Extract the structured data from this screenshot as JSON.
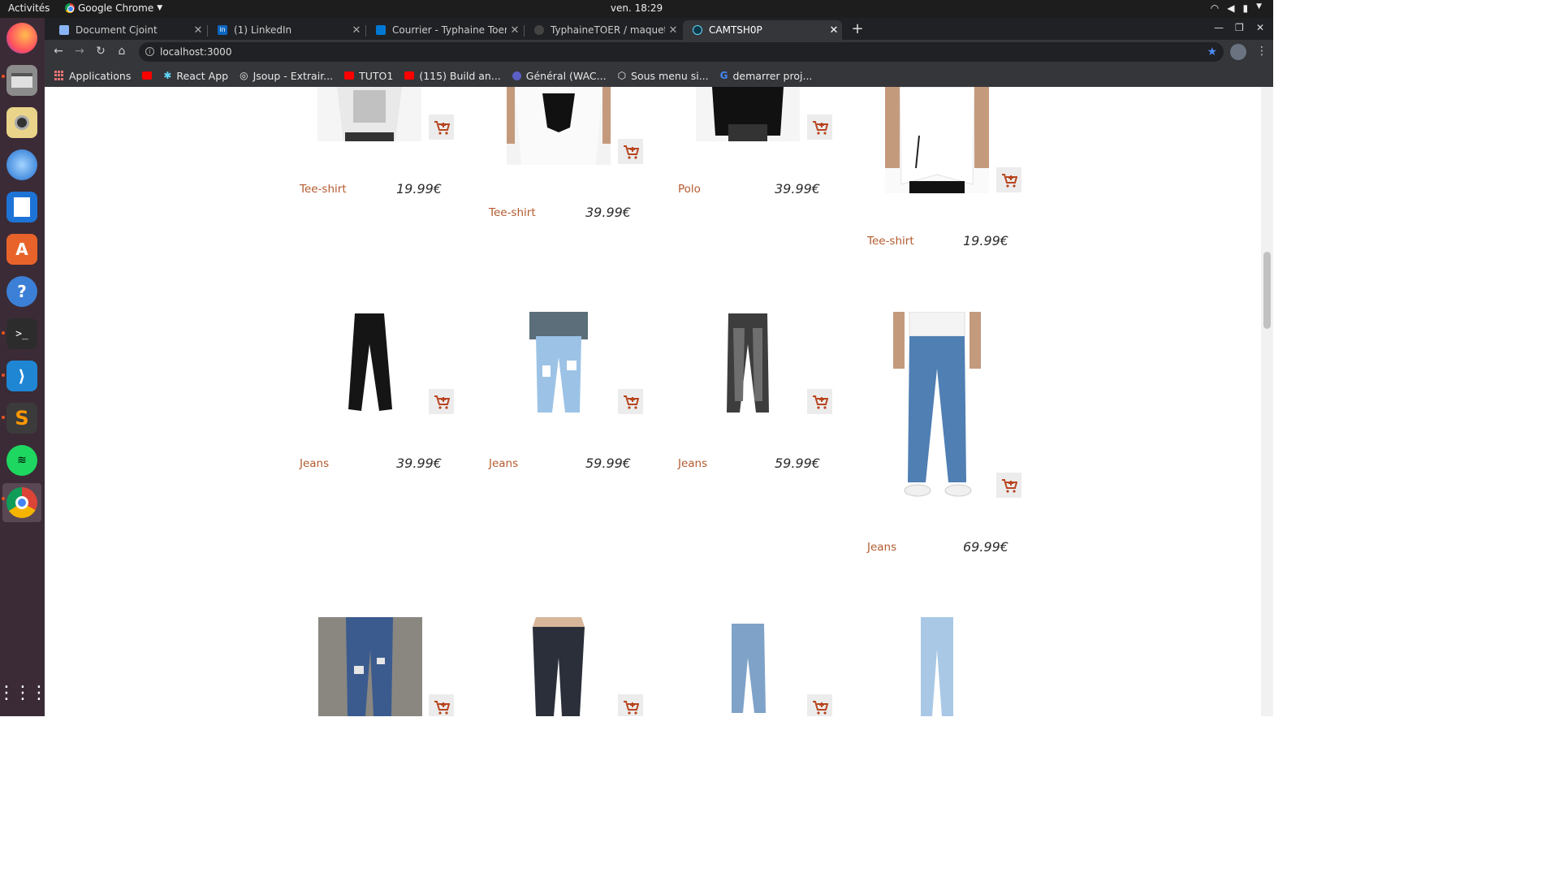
{
  "system": {
    "activities": "Activités",
    "app_name": "Google Chrome",
    "clock": "ven. 18:29"
  },
  "tabs": [
    {
      "title": "Document Cjoint",
      "favicon_color": "#8ab4f8"
    },
    {
      "title": "(1) LinkedIn",
      "favicon_color": "#0a66c2"
    },
    {
      "title": "Courrier - Typhaine Toer -",
      "favicon_color": "#0078d4"
    },
    {
      "title": "TyphaineTOER / maquette",
      "favicon_color": "#444444"
    },
    {
      "title": "CAMTSH0P",
      "favicon_color": "#61dafb"
    }
  ],
  "address_bar": {
    "url": "localhost:3000"
  },
  "bookmarks": [
    {
      "label": "Applications",
      "icon": "apps-grid-icon"
    },
    {
      "label": "",
      "icon": "youtube-icon"
    },
    {
      "label": "React App",
      "icon": "react-icon"
    },
    {
      "label": "Jsoup - Extrair...",
      "icon": "globe-icon"
    },
    {
      "label": "TUTO1",
      "icon": "youtube-icon"
    },
    {
      "label": "(115) Build an...",
      "icon": "youtube-icon"
    },
    {
      "label": "Général (WAC...",
      "icon": "teams-icon"
    },
    {
      "label": "Sous menu si...",
      "icon": "codepen-icon"
    },
    {
      "label": "demarrer proj...",
      "icon": "google-icon"
    }
  ],
  "products": [
    {
      "name": "Tee-shirt",
      "price": "19.99€"
    },
    {
      "name": "Tee-shirt",
      "price": "39.99€"
    },
    {
      "name": "Polo",
      "price": "39.99€"
    },
    {
      "name": "Tee-shirt",
      "price": "19.99€"
    },
    {
      "name": "Jeans",
      "price": "39.99€"
    },
    {
      "name": "Jeans",
      "price": "59.99€"
    },
    {
      "name": "Jeans",
      "price": "59.99€"
    },
    {
      "name": "Jeans",
      "price": "69.99€"
    },
    {
      "name": "",
      "price": ""
    },
    {
      "name": "",
      "price": ""
    },
    {
      "name": "",
      "price": ""
    },
    {
      "name": "",
      "price": ""
    }
  ],
  "colors": {
    "accent": "#b35a2e",
    "cart_icon": "#b8451f"
  }
}
